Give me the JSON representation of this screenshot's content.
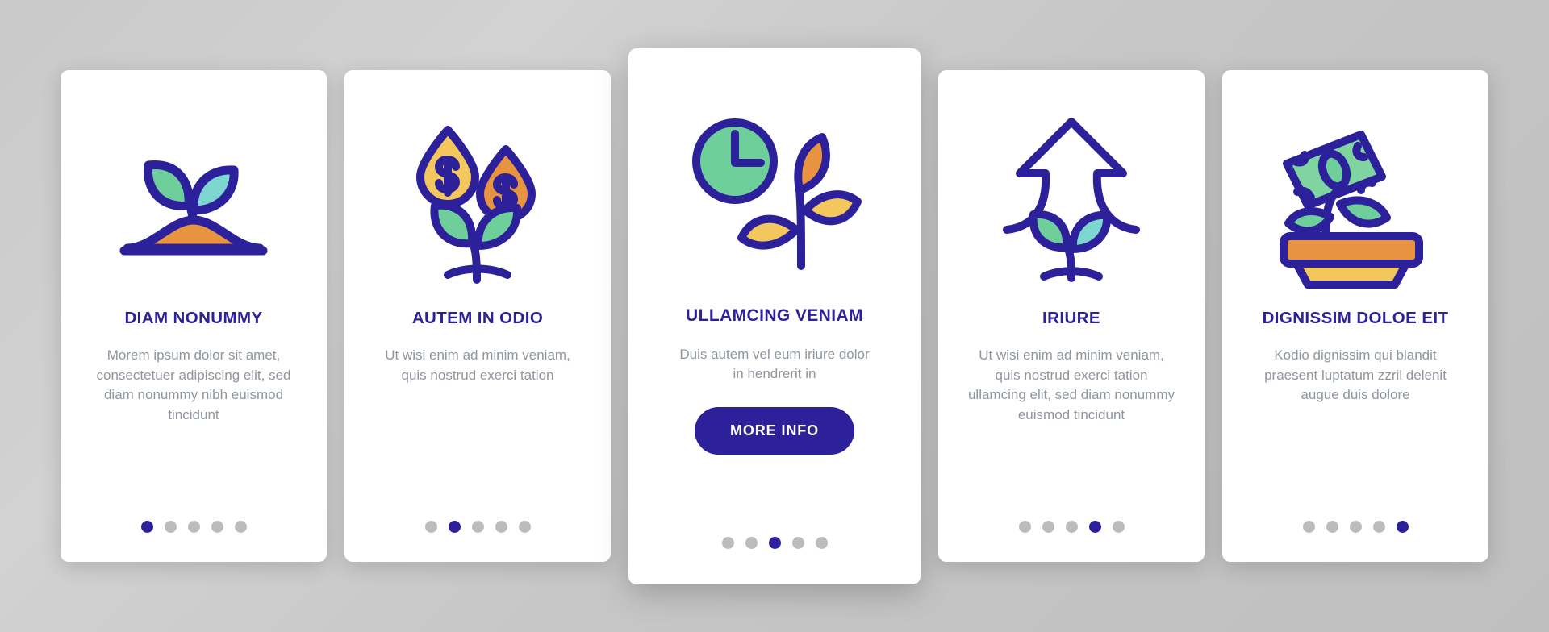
{
  "theme": {
    "background": "#c9c9c9",
    "card_bg": "#ffffff",
    "accent": "#2d219b",
    "body_text": "#8f969e",
    "dot_inactive": "#bcbcbc",
    "green": "#6ecf9a",
    "teal": "#7ed6d0",
    "orange": "#e8933f",
    "yellow": "#f3c75b"
  },
  "cards": [
    {
      "id": "card-1",
      "icon": "sprout-in-soil-icon",
      "title": "DIAM NONUMMY",
      "body": "Morem ipsum dolor sit amet, consectetuer adipiscing elit, sed diam nonummy nibh euismod tincidunt",
      "dots": {
        "count": 5,
        "active_index": 0
      },
      "featured": false,
      "cta": null
    },
    {
      "id": "card-2",
      "icon": "money-drops-plant-icon",
      "title": "AUTEM IN ODIO",
      "body": "Ut wisi enim ad minim veniam, quis nostrud exerci tation",
      "dots": {
        "count": 5,
        "active_index": 1
      },
      "featured": false,
      "cta": null
    },
    {
      "id": "card-3",
      "icon": "clock-plant-icon",
      "title": "ULLAMCING VENIAM",
      "body": "Duis autem vel eum iriure dolor in hendrerit in",
      "dots": {
        "count": 5,
        "active_index": 2
      },
      "featured": true,
      "cta": "MORE INFO"
    },
    {
      "id": "card-4",
      "icon": "growth-arrow-sprout-icon",
      "title": "IRIURE",
      "body": "Ut wisi enim ad minim veniam, quis nostrud exerci tation ullamcing elit, sed diam nonummy euismod tincidunt",
      "dots": {
        "count": 5,
        "active_index": 3
      },
      "featured": false,
      "cta": null
    },
    {
      "id": "card-5",
      "icon": "money-plant-pot-icon",
      "title": "DIGNISSIM DOLOE EIT",
      "body": "Kodio dignissim qui blandit praesent luptatum zzril delenit augue duis dolore",
      "dots": {
        "count": 5,
        "active_index": 4
      },
      "featured": false,
      "cta": null
    }
  ]
}
